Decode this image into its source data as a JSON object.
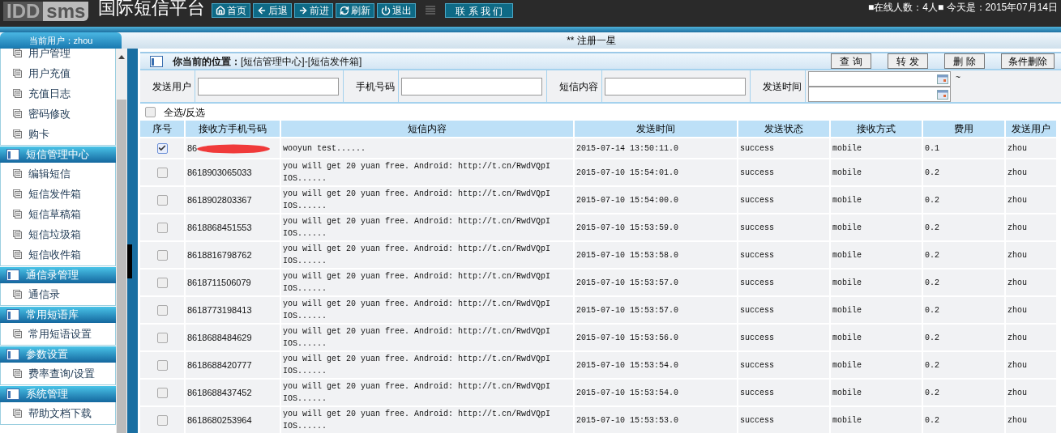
{
  "header": {
    "logo": {
      "left": "IDD",
      "right": "sms"
    },
    "title": "国际短信平台",
    "nav_buttons": [
      {
        "kind": "home",
        "label": "首页"
      },
      {
        "kind": "back",
        "label": "后退"
      },
      {
        "kind": "forward",
        "label": "前进"
      },
      {
        "kind": "refresh",
        "label": "刷新"
      },
      {
        "kind": "logout",
        "label": "退出"
      }
    ],
    "contact_button": "联 系 我 们",
    "status_text": "■在线人数：4人■ 今天是：2015年07月14日"
  },
  "sub_bar": {
    "current_user": "当前用户：zhou",
    "notice": "** 注册一星"
  },
  "sidebar": {
    "groups": [
      {
        "items": [
          "用户管理",
          "用户充值",
          "充值日志",
          "密码修改",
          "购卡"
        ]
      },
      {
        "title": "短信管理中心",
        "items": [
          "编辑短信",
          "短信发件箱",
          "短信草稿箱",
          "短信垃圾箱",
          "短信收件箱"
        ]
      },
      {
        "title": "通信录管理",
        "items": [
          "通信录"
        ]
      },
      {
        "title": "常用短语库",
        "items": [
          "常用短语设置"
        ]
      },
      {
        "title": "参数设置",
        "items": [
          "费率查询/设置"
        ]
      },
      {
        "title": "系统管理",
        "items": [
          "帮助文档下载"
        ]
      }
    ]
  },
  "location": {
    "label": "你当前的位置：",
    "path": "[短信管理中心]-[短信发件箱]"
  },
  "action_buttons": [
    "查 询",
    "转 发",
    "删 除",
    "条件删除"
  ],
  "filters": [
    {
      "kind": "text",
      "label": "发送用户"
    },
    {
      "kind": "text",
      "label": "手机号码"
    },
    {
      "kind": "text",
      "label": "短信内容"
    },
    {
      "kind": "date_range",
      "label": "发送时间",
      "separator": "~"
    }
  ],
  "select_all": {
    "label": "全选/反选",
    "checked": false
  },
  "table": {
    "columns": [
      "序号",
      "接收方手机号码",
      "短信内容",
      "发送时间",
      "发送状态",
      "接收方式",
      "费用",
      "发送用户"
    ],
    "rows": [
      {
        "selected": true,
        "redacted": true,
        "phone": "86",
        "content": "wooyun test......",
        "time": "2015-07-14 13:50:11.0",
        "status": "success",
        "method": "mobile",
        "fee": "0.1",
        "user": "zhou"
      },
      {
        "selected": false,
        "redacted": false,
        "phone": "8618903065033",
        "content": "you will get 20 yuan free. Android: http://t.cn/RwdVQpI IOS......",
        "time": "2015-07-10 15:54:01.0",
        "status": "success",
        "method": "mobile",
        "fee": "0.2",
        "user": "zhou"
      },
      {
        "selected": false,
        "redacted": false,
        "phone": "8618902803367",
        "content": "you will get 20 yuan free. Android: http://t.cn/RwdVQpI IOS......",
        "time": "2015-07-10 15:54:00.0",
        "status": "success",
        "method": "mobile",
        "fee": "0.2",
        "user": "zhou"
      },
      {
        "selected": false,
        "redacted": false,
        "phone": "8618868451553",
        "content": "you will get 20 yuan free. Android: http://t.cn/RwdVQpI IOS......",
        "time": "2015-07-10 15:53:59.0",
        "status": "success",
        "method": "mobile",
        "fee": "0.2",
        "user": "zhou"
      },
      {
        "selected": false,
        "redacted": false,
        "phone": "8618816798762",
        "content": "you will get 20 yuan free. Android: http://t.cn/RwdVQpI IOS......",
        "time": "2015-07-10 15:53:58.0",
        "status": "success",
        "method": "mobile",
        "fee": "0.2",
        "user": "zhou"
      },
      {
        "selected": false,
        "redacted": false,
        "phone": "8618711506079",
        "content": "you will get 20 yuan free. Android: http://t.cn/RwdVQpI IOS......",
        "time": "2015-07-10 15:53:57.0",
        "status": "success",
        "method": "mobile",
        "fee": "0.2",
        "user": "zhou"
      },
      {
        "selected": false,
        "redacted": false,
        "phone": "8618773198413",
        "content": "you will get 20 yuan free. Android: http://t.cn/RwdVQpI IOS......",
        "time": "2015-07-10 15:53:57.0",
        "status": "success",
        "method": "mobile",
        "fee": "0.2",
        "user": "zhou"
      },
      {
        "selected": false,
        "redacted": false,
        "phone": "8618688484629",
        "content": "you will get 20 yuan free. Android: http://t.cn/RwdVQpI IOS......",
        "time": "2015-07-10 15:53:56.0",
        "status": "success",
        "method": "mobile",
        "fee": "0.2",
        "user": "zhou"
      },
      {
        "selected": false,
        "redacted": false,
        "phone": "8618688420777",
        "content": "you will get 20 yuan free. Android: http://t.cn/RwdVQpI IOS......",
        "time": "2015-07-10 15:53:54.0",
        "status": "success",
        "method": "mobile",
        "fee": "0.2",
        "user": "zhou"
      },
      {
        "selected": false,
        "redacted": false,
        "phone": "8618688437452",
        "content": "you will get 20 yuan free. Android: http://t.cn/RwdVQpI IOS......",
        "time": "2015-07-10 15:53:54.0",
        "status": "success",
        "method": "mobile",
        "fee": "0.2",
        "user": "zhou"
      },
      {
        "selected": false,
        "redacted": false,
        "phone": "8618680253964",
        "content": "you will get 20 yuan free. Android: http://t.cn/RwdVQpI IOS......",
        "time": "2015-07-10 15:53:53.0",
        "status": "success",
        "method": "mobile",
        "fee": "0.2",
        "user": "zhou"
      }
    ]
  }
}
